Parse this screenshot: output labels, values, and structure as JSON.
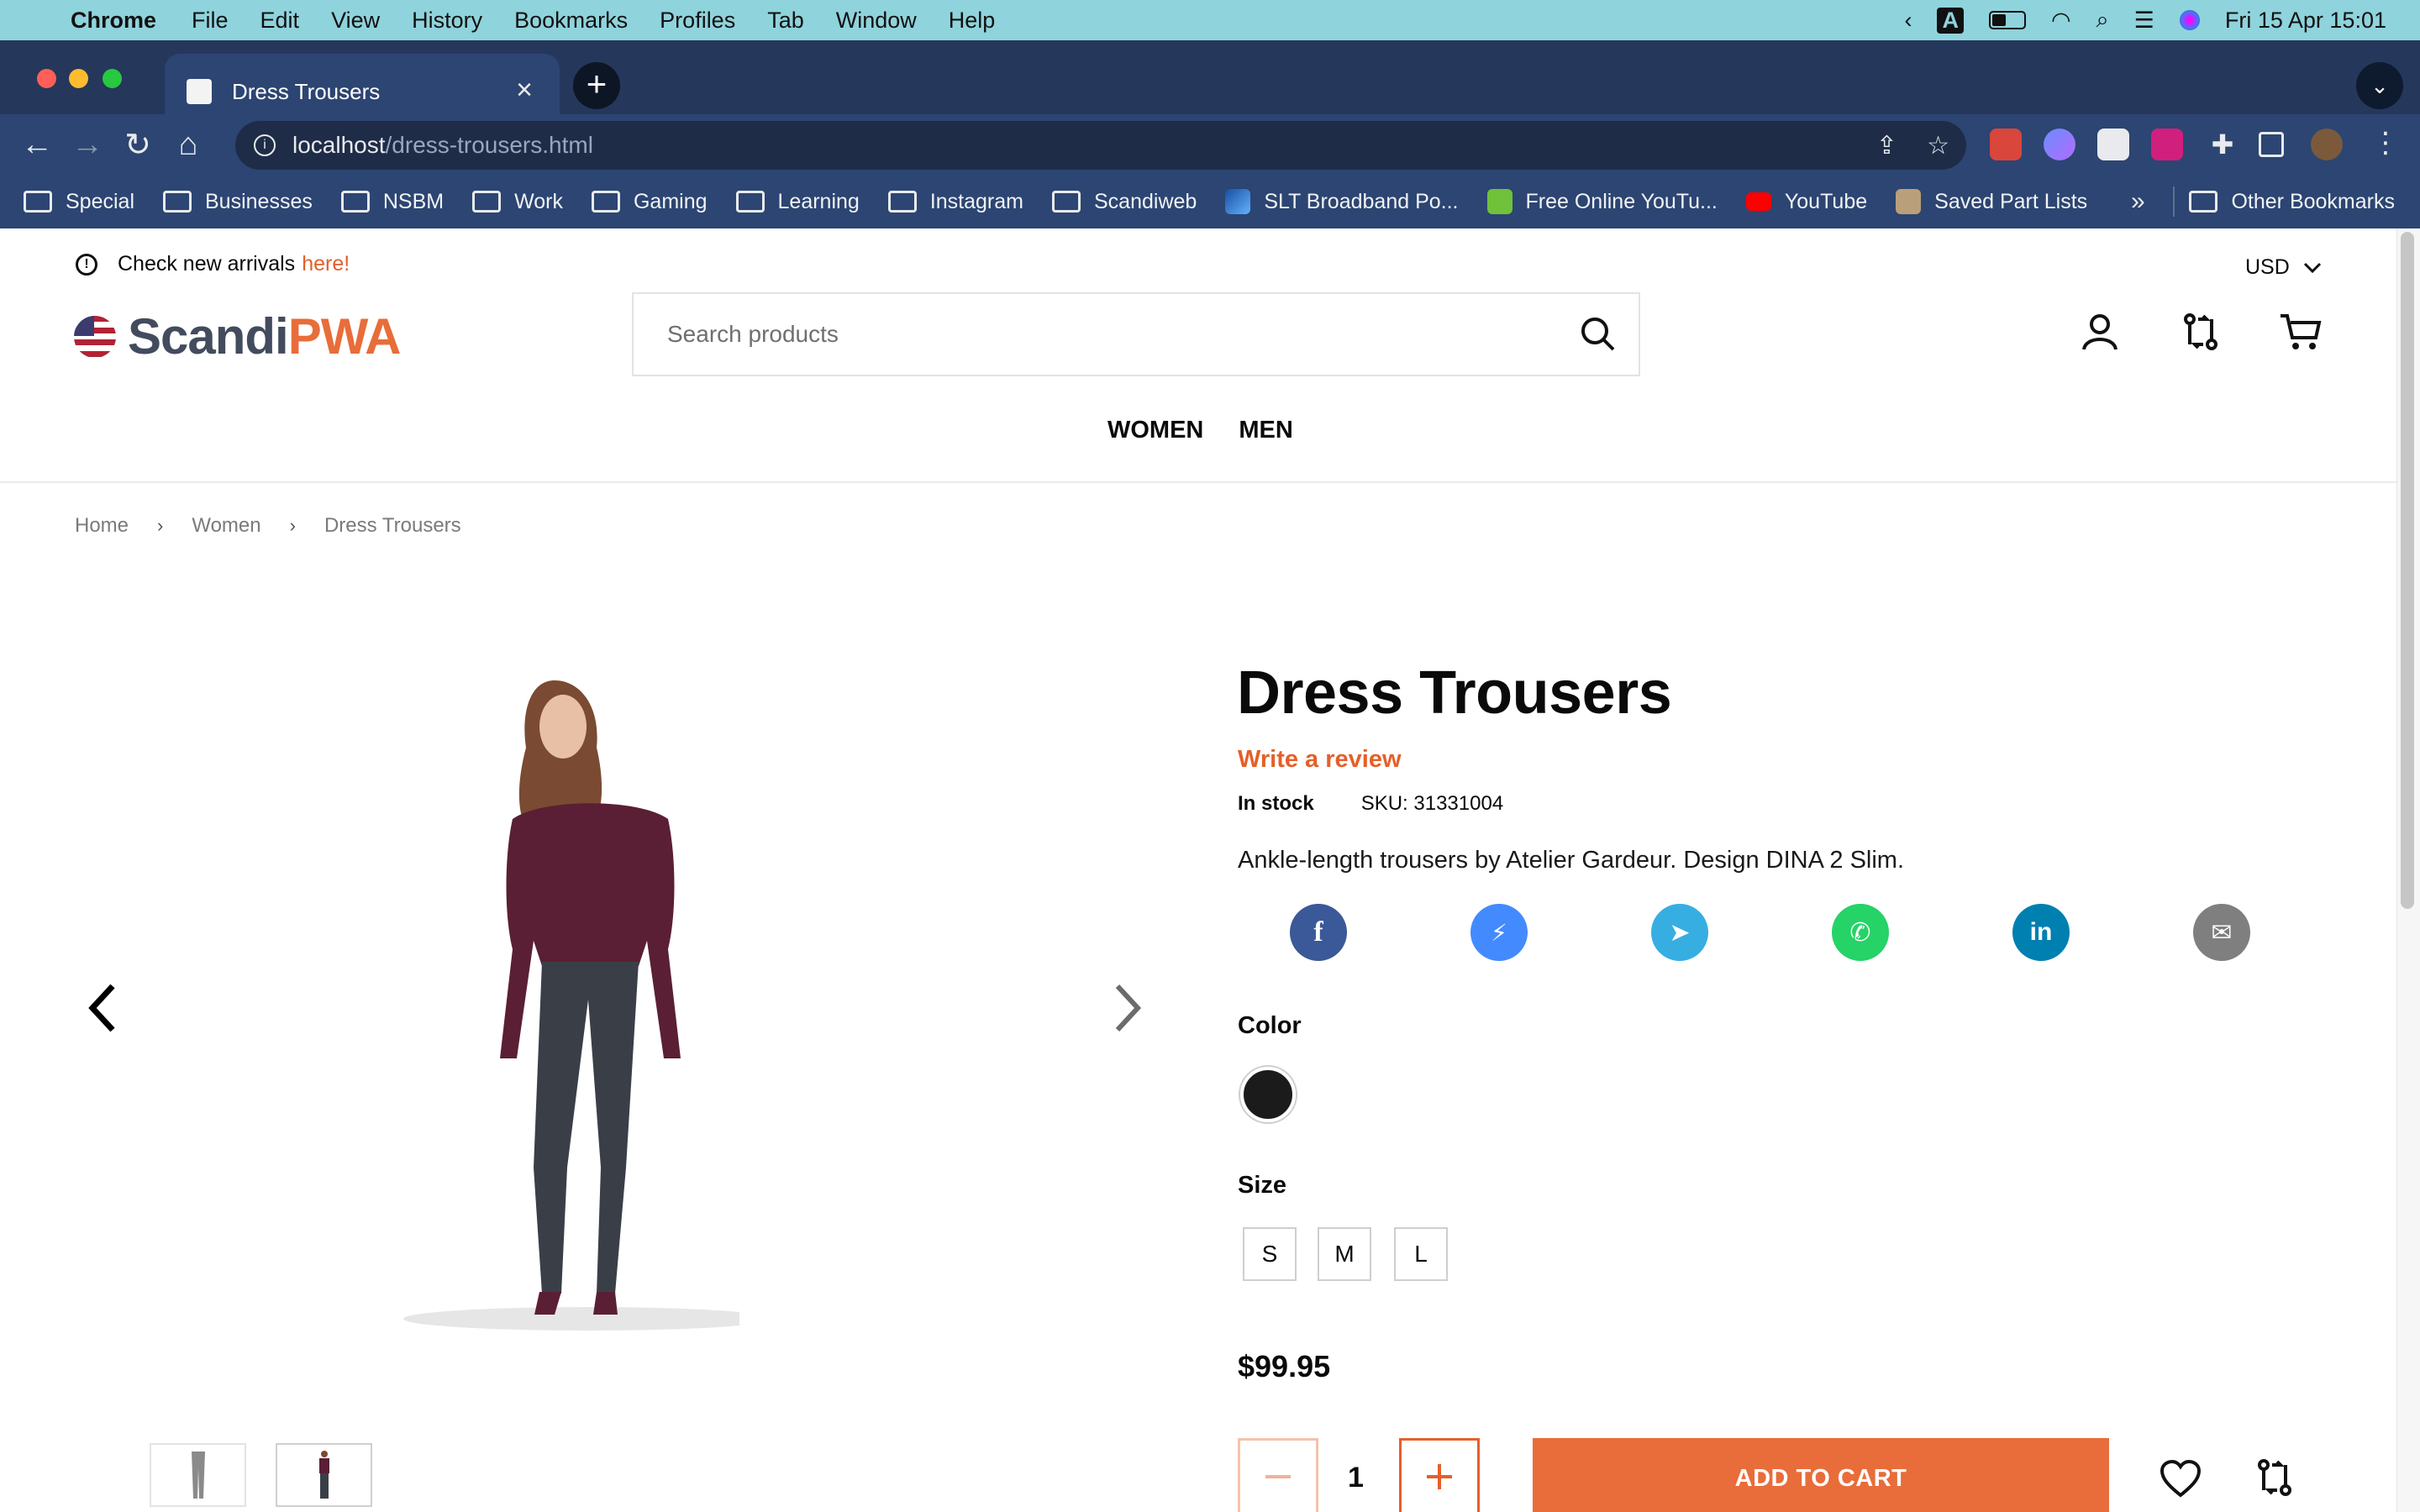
{
  "os_menubar": {
    "app": "Chrome",
    "items": [
      "File",
      "Edit",
      "View",
      "History",
      "Bookmarks",
      "Profiles",
      "Tab",
      "Window",
      "Help"
    ],
    "datetime": "Fri 15 Apr  15:01"
  },
  "browser": {
    "tab_title": "Dress Trousers",
    "url_host": "localhost",
    "url_path": "/dress-trousers.html",
    "bookmarks": [
      {
        "label": "Special",
        "icon": "folder-icon"
      },
      {
        "label": "Businesses",
        "icon": "folder-icon"
      },
      {
        "label": "NSBM",
        "icon": "folder-icon"
      },
      {
        "label": "Work",
        "icon": "folder-icon"
      },
      {
        "label": "Gaming",
        "icon": "folder-icon"
      },
      {
        "label": "Learning",
        "icon": "folder-icon"
      },
      {
        "label": "Instagram",
        "icon": "folder-icon"
      },
      {
        "label": "Scandiweb",
        "icon": "folder-icon"
      },
      {
        "label": "SLT Broadband Po...",
        "icon": "slt-icon"
      },
      {
        "label": "Free Online YouTu...",
        "icon": "download-icon"
      },
      {
        "label": "YouTube",
        "icon": "youtube-icon"
      },
      {
        "label": "Saved Part Lists",
        "icon": "part-icon"
      }
    ],
    "overflow": "»",
    "other_bookmarks": "Other Bookmarks"
  },
  "header": {
    "notice_text": "Check new arrivals",
    "notice_link": "here!",
    "currency": "USD",
    "logo_part1": "Scandi",
    "logo_part2": "PWA",
    "search_placeholder": "Search products",
    "nav": [
      "WOMEN",
      "MEN"
    ]
  },
  "breadcrumbs": [
    "Home",
    "Women",
    "Dress Trousers"
  ],
  "product": {
    "title": "Dress Trousers",
    "review_link": "Write a review",
    "stock": "In stock",
    "sku": "SKU: 31331004",
    "description": "Ankle-length trousers by Atelier Gardeur. Design DINA 2 Slim.",
    "share": [
      {
        "name": "facebook",
        "color": "#3b5998",
        "glyph": "f"
      },
      {
        "name": "messenger",
        "color": "#448aff",
        "glyph": "⚡"
      },
      {
        "name": "telegram",
        "color": "#37aee2",
        "glyph": "➤"
      },
      {
        "name": "whatsapp",
        "color": "#25d366",
        "glyph": "✆"
      },
      {
        "name": "linkedin",
        "color": "#007fb1",
        "glyph": "in"
      },
      {
        "name": "email",
        "color": "#7f7f7f",
        "glyph": "✉"
      }
    ],
    "color_label": "Color",
    "size_label": "Size",
    "sizes": [
      "S",
      "M",
      "L"
    ],
    "price": "$99.95",
    "quantity": "1",
    "add_to_cart": "ADD TO CART",
    "accent": "#e86d3a"
  }
}
